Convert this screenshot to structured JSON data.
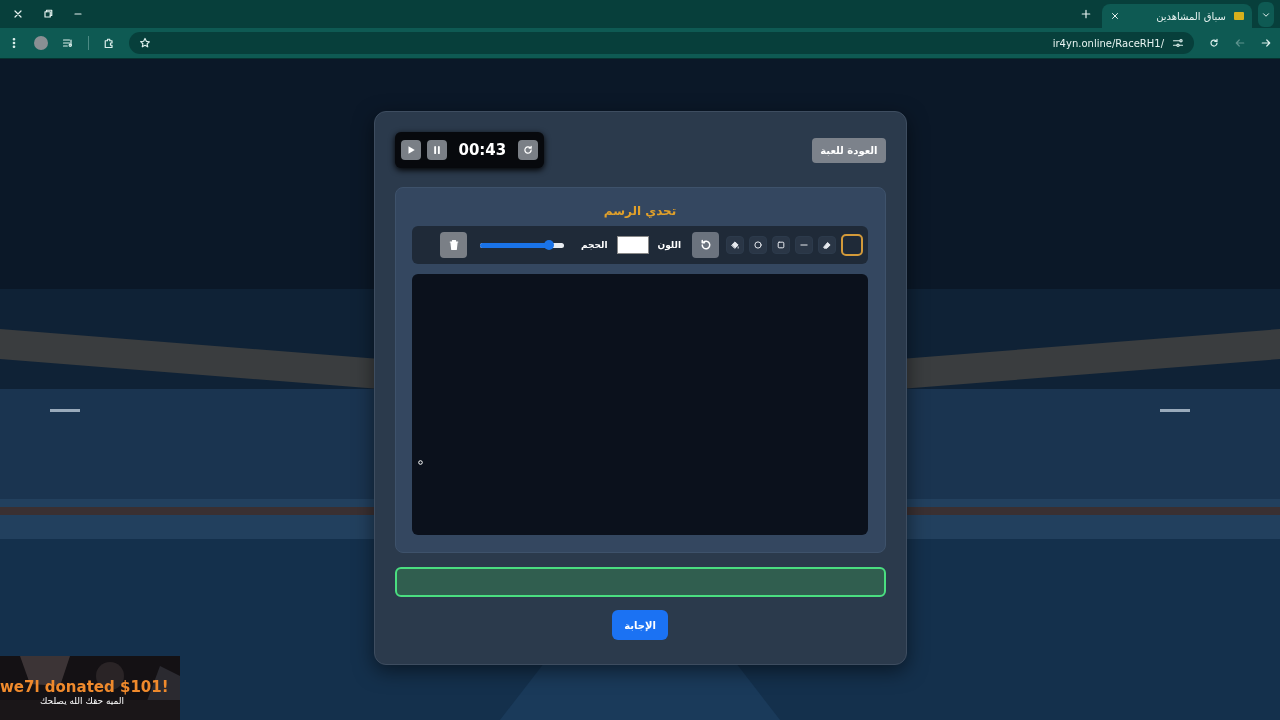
{
  "browser": {
    "tab_title": "سباق المشاهدين",
    "url": "ir4yn.online/RaceRH1/"
  },
  "timer": {
    "time": "00:43"
  },
  "back_button": "العودة للعبة",
  "drawing": {
    "title": "تحدي الرسم",
    "tools": [
      {
        "kind": "brush",
        "selected": true
      },
      {
        "kind": "eraser",
        "selected": false
      },
      {
        "kind": "line",
        "selected": false
      },
      {
        "kind": "rect",
        "selected": false
      },
      {
        "kind": "circle",
        "selected": false
      },
      {
        "kind": "fill",
        "selected": false
      }
    ],
    "color_label": "اللون",
    "size_label": "الحجم",
    "size": {
      "level": 0.82
    }
  },
  "answer": {
    "button": "الإجابة"
  },
  "donation": {
    "headline": "we7l donated $101!",
    "message": "الميه حقك الله يصلحك"
  }
}
